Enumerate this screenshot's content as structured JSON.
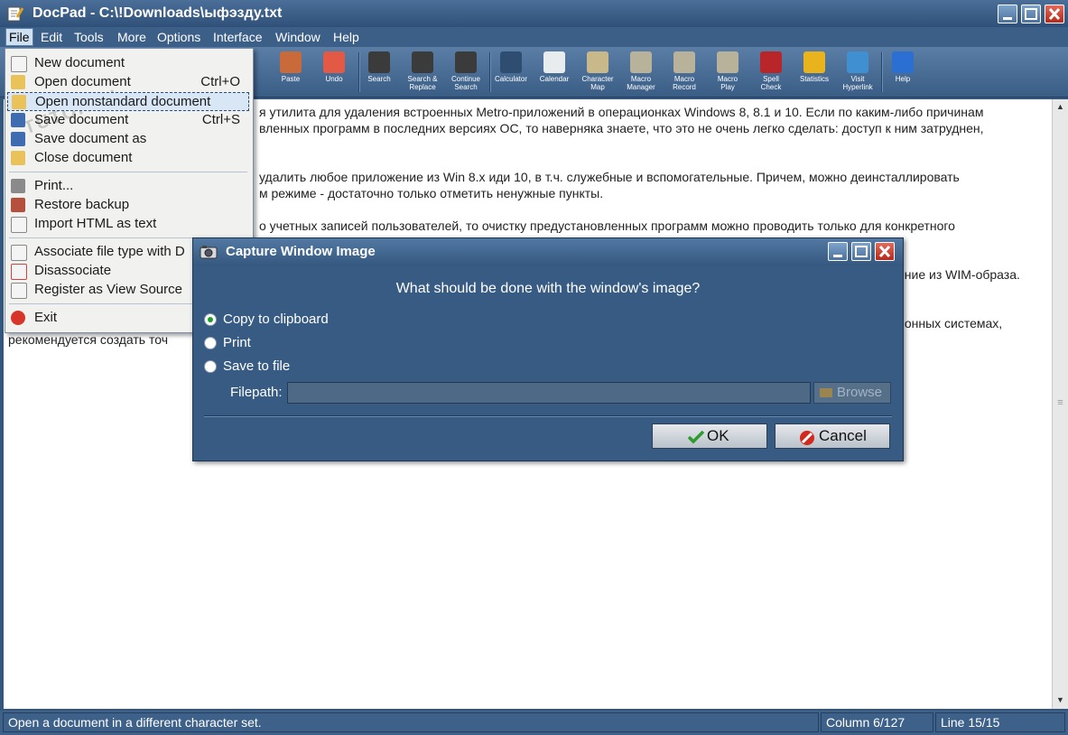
{
  "window": {
    "title": "DocPad - C:\\!Downloads\\ыфэзду.txt"
  },
  "menubar": {
    "items": [
      "File",
      "Edit",
      "Tools",
      "More",
      "Options",
      "Interface",
      "Window",
      "Help"
    ]
  },
  "toolbar": {
    "items": [
      {
        "label": "Paste",
        "icon": "paste-icon",
        "color": "#c96a3a"
      },
      {
        "label": "Undo",
        "icon": "undo-icon",
        "color": "#e25a46"
      },
      {
        "label": "Search",
        "icon": "binoculars-icon",
        "color": "#3b3b3b"
      },
      {
        "label": "Search &\nReplace",
        "icon": "search-replace-icon",
        "color": "#3b3b3b"
      },
      {
        "label": "Continue\nSearch",
        "icon": "continue-search-icon",
        "color": "#3b3b3b"
      },
      {
        "label": "Calculator",
        "icon": "calculator-icon",
        "color": "#2f4d70"
      },
      {
        "label": "Calendar",
        "icon": "calendar-icon",
        "color": "#e9ecef"
      },
      {
        "label": "Character\nMap",
        "icon": "character-map-icon",
        "color": "#c9b98a"
      },
      {
        "label": "Macro\nManager",
        "icon": "macro-manager-icon",
        "color": "#b9b29a"
      },
      {
        "label": "Macro\nRecord",
        "icon": "macro-record-icon",
        "color": "#b9b29a"
      },
      {
        "label": "Macro\nPlay",
        "icon": "macro-play-icon",
        "color": "#b9b29a"
      },
      {
        "label": "Spell\nCheck",
        "icon": "spell-check-icon",
        "color": "#b8262a"
      },
      {
        "label": "Statistics",
        "icon": "pie-chart-icon",
        "color": "#e8b31c"
      },
      {
        "label": "Visit\nHyperlink",
        "icon": "globe-icon",
        "color": "#3f8fd1"
      },
      {
        "label": "Help",
        "icon": "help-icon",
        "color": "#2a6fd1"
      }
    ]
  },
  "file_menu": {
    "items": [
      {
        "label": "New document",
        "shortcut": "",
        "icon": "new-document-icon"
      },
      {
        "label": "Open document",
        "shortcut": "Ctrl+O",
        "icon": "open-folder-icon"
      },
      {
        "label": "Open nonstandard document",
        "shortcut": "",
        "icon": "open-nonstandard-icon"
      },
      {
        "label": "Save document",
        "shortcut": "Ctrl+S",
        "icon": "save-icon"
      },
      {
        "label": "Save document as",
        "shortcut": "",
        "icon": "save-as-icon"
      },
      {
        "label": "Close document",
        "shortcut": "",
        "icon": "close-folder-icon"
      },
      {
        "label": "Print...",
        "shortcut": "",
        "icon": "print-icon"
      },
      {
        "label": "Restore backup",
        "shortcut": "",
        "icon": "restore-icon"
      },
      {
        "label": "Import HTML as text",
        "shortcut": "",
        "icon": "import-html-icon"
      },
      {
        "label": "Associate file type with D",
        "shortcut": "",
        "icon": "associate-icon"
      },
      {
        "label": "Disassociate",
        "shortcut": "",
        "icon": "disassociate-icon"
      },
      {
        "label": "Register as View Source",
        "shortcut": "",
        "icon": "register-icon"
      },
      {
        "label": "Exit",
        "shortcut": "",
        "icon": "exit-icon"
      }
    ]
  },
  "editor": {
    "lines": [
      "я утилита для удаления встроенных Metro-приложений в операционках Windows 8, 8.1 и 10. Если по каким-либо причинам",
      "вленных программ в последних версиях ОС, то наверняка знаете, что это не очень легко сделать: доступ к ним затруднен,",
      "удалить любое приложение из Win 8.x иди 10, в т.ч. служебные и вспомогательные. Причем, можно деинсталлировать",
      "м режиме - достаточно только отметить ненужные пункты.",
      "о учетных записей пользователей, то очистку предустановленных программ можно проводить только для конкретного",
      "ение из WIM-образа.",
      "ионных системах,",
      "рекомендуется создать точ"
    ]
  },
  "dialog": {
    "title": "Capture Window Image",
    "question": "What should be done with the window's image?",
    "options": [
      "Copy to clipboard",
      "Print",
      "Save to file"
    ],
    "selected": "Copy to clipboard",
    "filepath_label": "Filepath:",
    "filepath_value": "",
    "browse_label": "Browse",
    "ok_label": "OK",
    "cancel_label": "Cancel"
  },
  "statusbar": {
    "message": "Open a document in a different character set.",
    "column": "Column 6/127",
    "line": "Line 15/15"
  }
}
